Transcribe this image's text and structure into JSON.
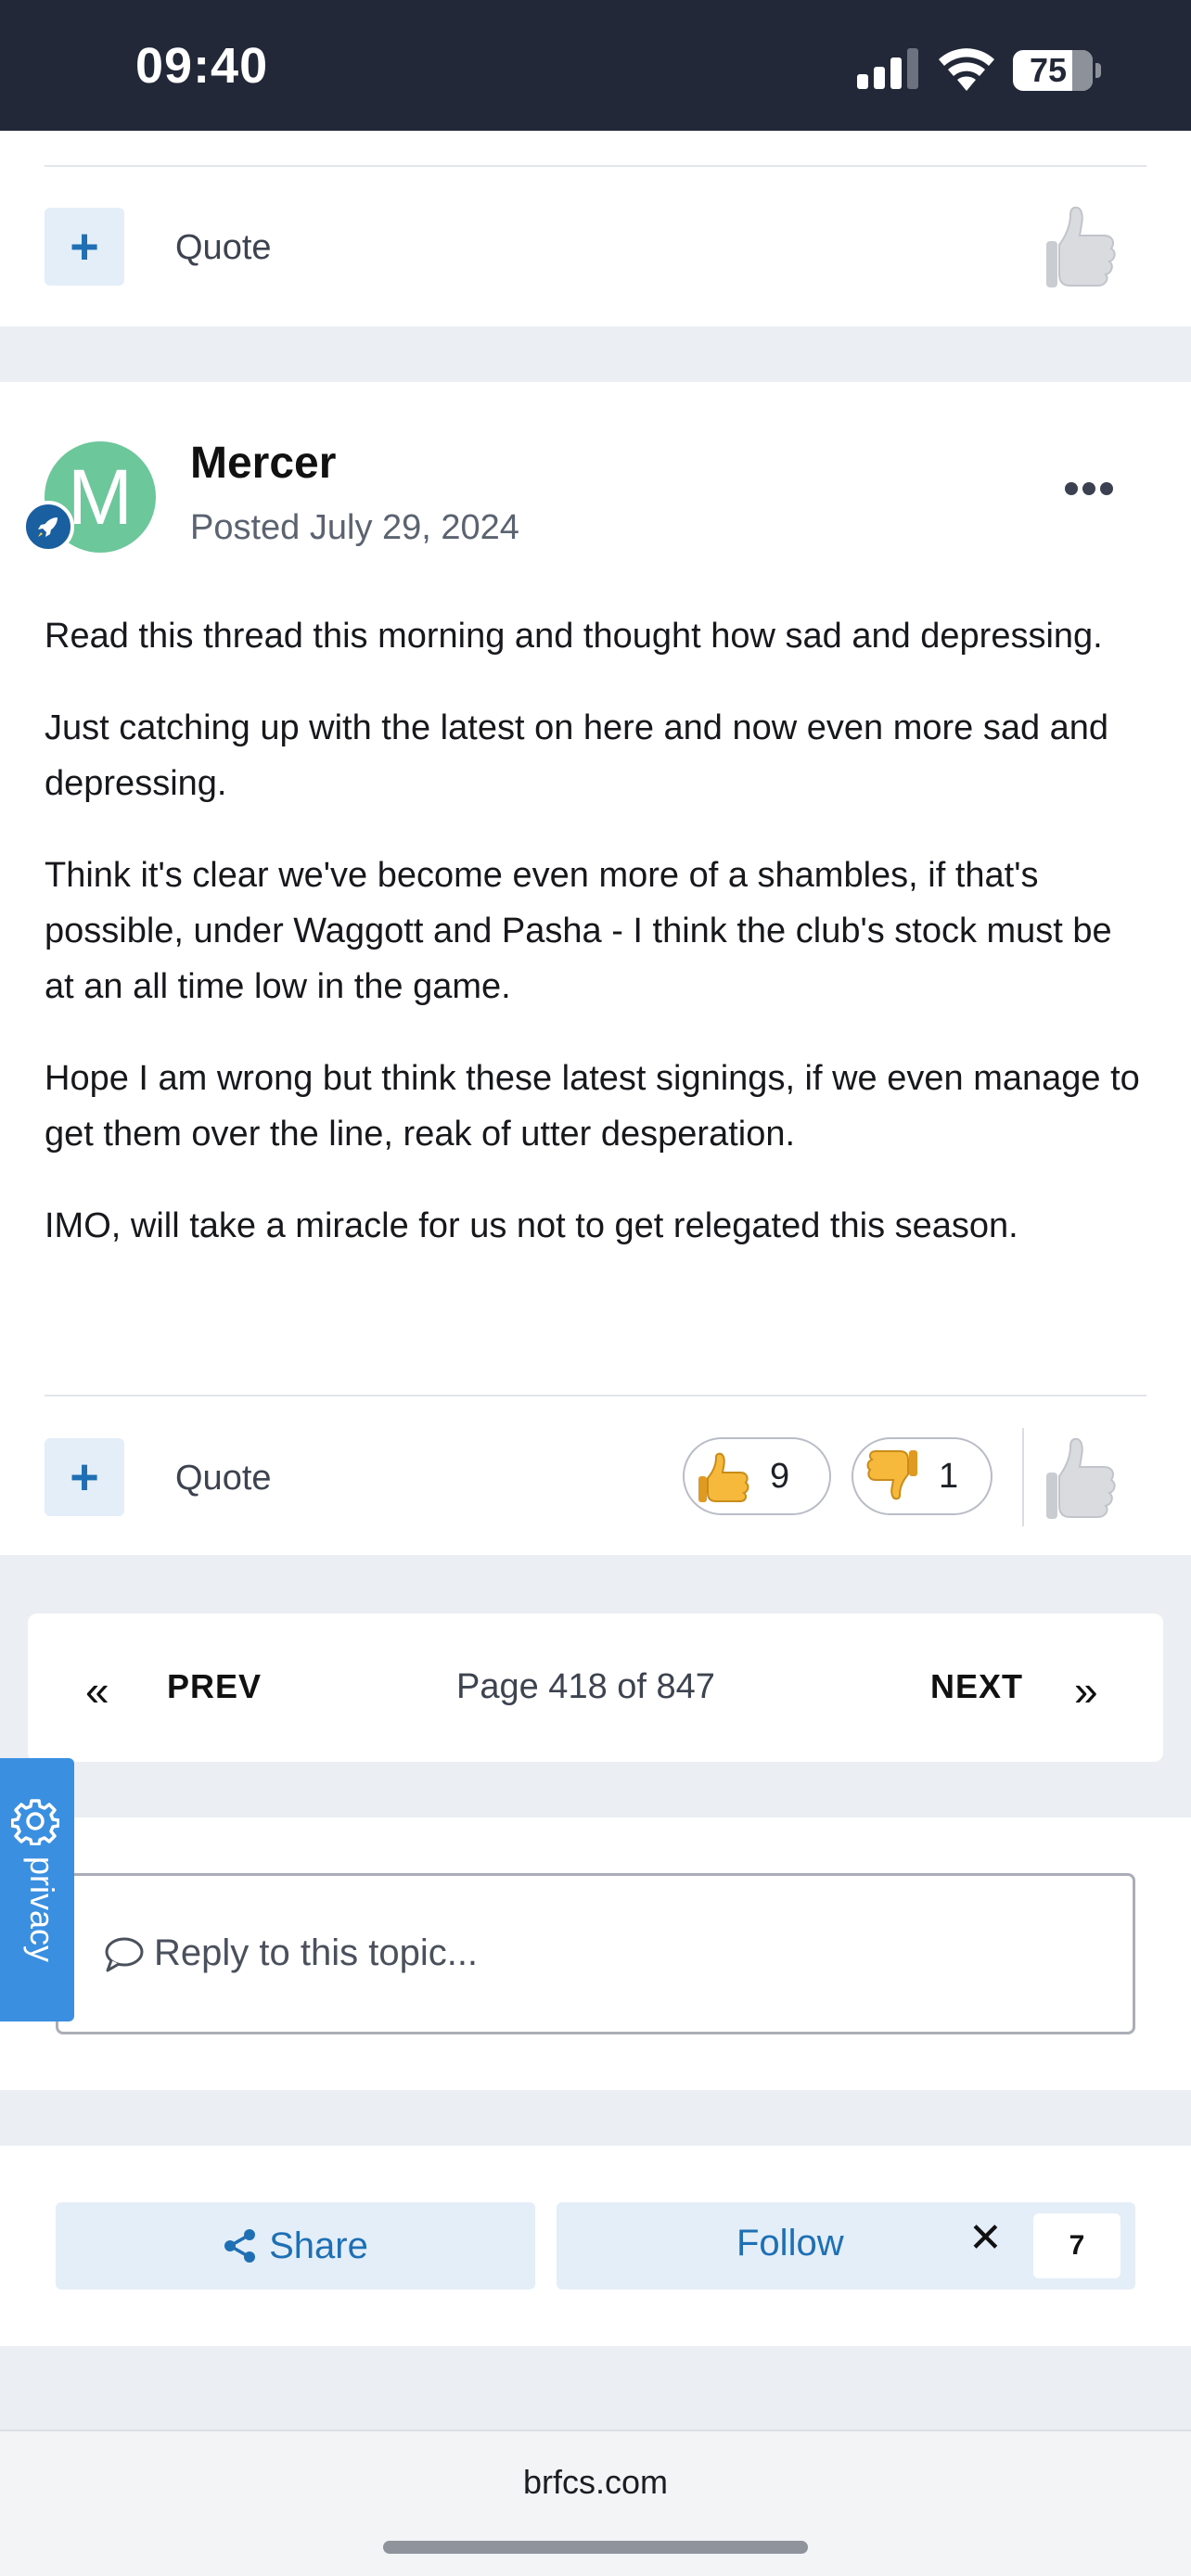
{
  "status_bar": {
    "time": "09:40",
    "battery": "75",
    "battery_level": 0.75,
    "icons": [
      "cellular-signal-icon",
      "wifi-icon",
      "battery-icon"
    ]
  },
  "previous_post_footer": {
    "add_icon": "plus-icon",
    "quote_label": "Quote",
    "reaction_icon": "thumbs-up-icon"
  },
  "post": {
    "avatar_letter": "M",
    "rank_icon": "rocket-icon",
    "author": "Mercer",
    "posted": "Posted July 29, 2024",
    "menu_icon": "more-dots-icon",
    "paragraphs": [
      "Read this thread this morning and thought how sad and depressing.",
      "Just catching up with the latest on here and now even more sad and depressing.",
      "Think it's clear we've become even more of a shambles, if that's possible, under Waggott and Pasha - I think the club's stock must be at an all time low in the game.",
      "Hope I am wrong but think these latest signings, if we even manage to get them over the line, reak of utter desperation.",
      "IMO, will take a miracle for us not to get relegated this season."
    ],
    "footer": {
      "add_icon": "plus-icon",
      "quote_label": "Quote",
      "reactions": [
        {
          "icon": "thumbs-up-icon",
          "count": "9"
        },
        {
          "icon": "thumbs-down-icon",
          "count": "1"
        }
      ],
      "react_icon": "thumbs-up-icon"
    }
  },
  "pagination": {
    "prev_icon": "«",
    "prev_label": "PREV",
    "page_info": "Page 418 of 847",
    "next_label": "NEXT",
    "next_icon": "»"
  },
  "reply": {
    "placeholder": "Reply to this topic...",
    "icon": "speech-bubble-icon"
  },
  "privacy": {
    "label": "privacy",
    "icon": "gear-icon"
  },
  "actions": {
    "share_label": "Share",
    "share_icon": "share-icon",
    "follow_label": "Follow",
    "follow_close": "✕",
    "follow_count": "7"
  },
  "browser": {
    "url": "brfcs.com"
  },
  "colors": {
    "status_bar": "#222838",
    "page_bg": "#ebeef2",
    "accent": "#1f6fb5",
    "avatar": "#6cc79a",
    "privacy_tab": "#3b8fe0"
  }
}
